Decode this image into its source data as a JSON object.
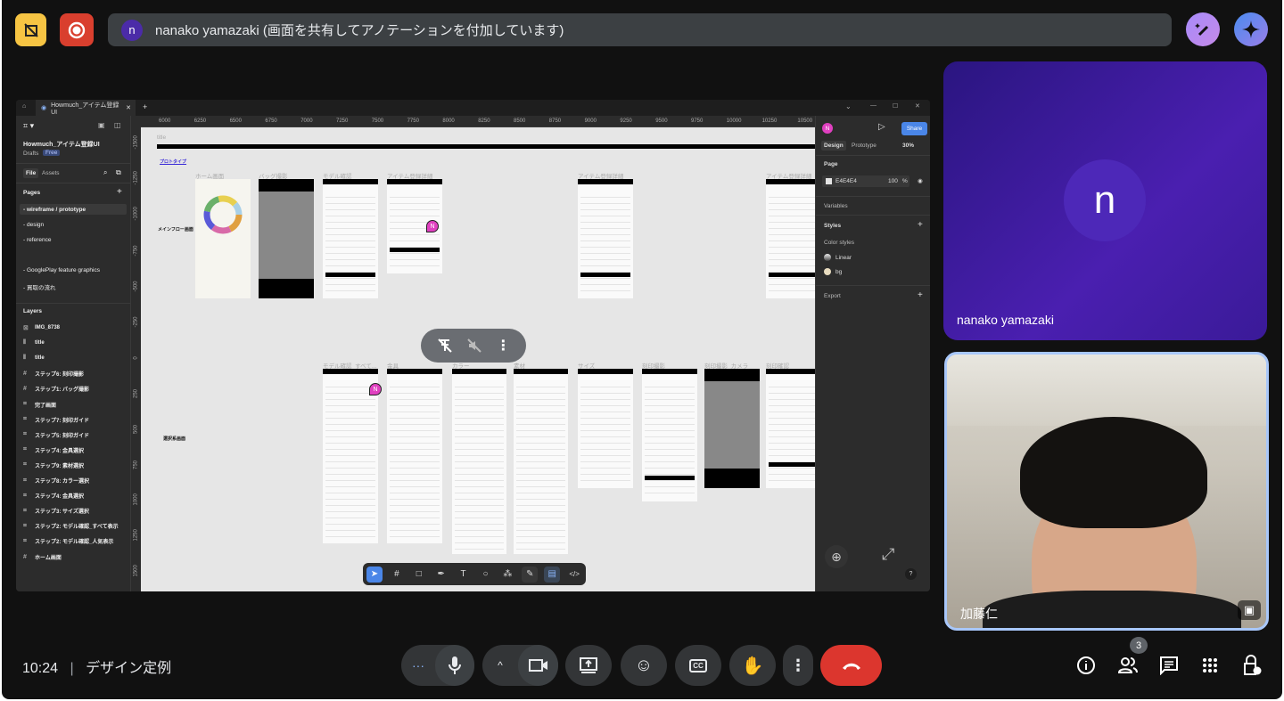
{
  "meet": {
    "presenter_banner": "nanako yamazaki (画面を共有してアノテーションを付加しています)",
    "presenter_initial": "n",
    "time": "10:24",
    "separator": "|",
    "meeting_title": "デザイン定例",
    "people_count": "3",
    "participants": [
      {
        "name": "nanako yamazaki",
        "initial": "n"
      },
      {
        "name": "加藤仁"
      }
    ],
    "colors": {
      "end_call": "#dc362e",
      "tile_border": "#a8c7fa",
      "presenter": "#4b2ba8"
    }
  },
  "figma": {
    "tab_title": "Howmuch_アイテム登録UI",
    "file_name": "Howmuch_アイテム登録UI",
    "drafts": "Drafts",
    "plan_badge": "Free",
    "panel_tabs": [
      "File",
      "Assets"
    ],
    "pages_header": "Pages",
    "pages": [
      "- wireframe / prototype",
      "- design",
      "- reference",
      "- GooglePlay feature graphics",
      "- 買取の流れ"
    ],
    "layers_header": "Layers",
    "layers": [
      {
        "icon": "image",
        "name": "IMG_8738"
      },
      {
        "icon": "text",
        "name": "title"
      },
      {
        "icon": "text",
        "name": "title"
      },
      {
        "icon": "frame",
        "name": "ステップ6: 刻印撮影"
      },
      {
        "icon": "frame",
        "name": "ステップ1: バッグ撮影"
      },
      {
        "icon": "component",
        "name": "完了画面"
      },
      {
        "icon": "component",
        "name": "ステップ7: 刻印ガイド"
      },
      {
        "icon": "component",
        "name": "ステップ5: 刻印ガイド"
      },
      {
        "icon": "component",
        "name": "ステップ4: 金具選択"
      },
      {
        "icon": "component",
        "name": "ステップ9: 素材選択"
      },
      {
        "icon": "component",
        "name": "ステップ8: カラー選択"
      },
      {
        "icon": "component",
        "name": "ステップ4: 金具選択"
      },
      {
        "icon": "component",
        "name": "ステップ3: サイズ選択"
      },
      {
        "icon": "component",
        "name": "ステップ2: モデル確認_すべて表示"
      },
      {
        "icon": "component",
        "name": "ステップ2: モデル確認_人気表示"
      },
      {
        "icon": "frame",
        "name": "ホーム画面"
      }
    ],
    "ruler_x": [
      "6000",
      "6250",
      "6500",
      "6750",
      "7000",
      "7250",
      "7500",
      "7750",
      "8000",
      "8250",
      "8500",
      "8750",
      "9000",
      "9250",
      "9500",
      "9750",
      "10000",
      "10250",
      "10500"
    ],
    "ruler_y": [
      "-1500",
      "-1250",
      "-1000",
      "-750",
      "-500",
      "-250",
      "0",
      "250",
      "500",
      "750",
      "1000",
      "1250",
      "1500"
    ],
    "canvas": {
      "title_label": "title",
      "prototype_link": "プロトタイプ",
      "main_flow_label": "メインフロー画面",
      "selection_label": "選択系画面",
      "top_frames": [
        "ホーム画面",
        "バッグ撮影",
        "モデル確認",
        "アイテム登録詳細",
        "アイテム登録詳細",
        "アイテム登録詳細"
      ],
      "bottom_frames": [
        "モデル確認_すべて...",
        "金具",
        "カラー",
        "素材",
        "サイズ",
        "刻印撮影",
        "刻印撮影_カメラ",
        "刻印確認"
      ],
      "cursor_initial": "N"
    },
    "right_panel": {
      "user_initial": "N",
      "share": "Share",
      "tabs": [
        "Design",
        "Prototype"
      ],
      "zoom": "30%",
      "page_header": "Page",
      "page_color": "E4E4E4",
      "page_opacity": "100",
      "percent": "%",
      "variables": "Variables",
      "styles": "Styles",
      "color_styles": "Color styles",
      "styles_list": [
        "Linear",
        "bg"
      ],
      "export": "Export"
    },
    "help": "?"
  }
}
